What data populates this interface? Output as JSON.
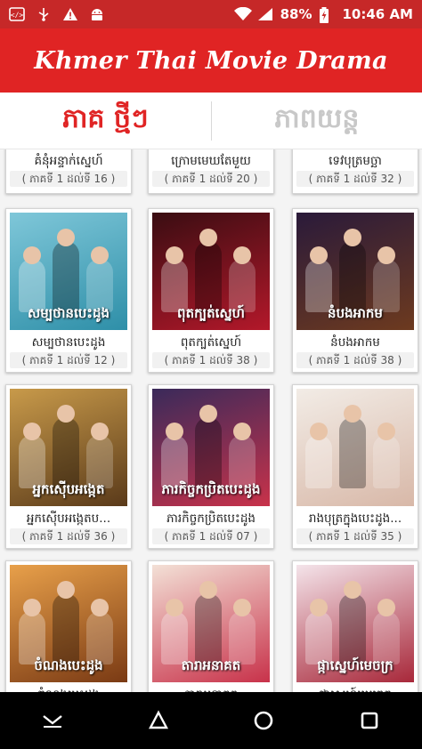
{
  "status_bar": {
    "battery": "88%",
    "time": "10:46 AM",
    "background": "#c62828"
  },
  "app_bar": {
    "title": "Khmer Thai Movie Drama",
    "background": "#e02424"
  },
  "tabs": [
    {
      "label": "ភាគ ថ្មីៗ",
      "active": true
    },
    {
      "label": "ភាពយន្ដ",
      "active": false
    }
  ],
  "partial_row": [
    {
      "title": "គំនុំអន្ទាក់ស្នេហ៍",
      "episodes": "( ភាគទី 1 ដល់ទី 16 )"
    },
    {
      "title": "ក្រោមមេឃតែមួយ",
      "episodes": "( ភាគទី 1 ដល់ទី 20 )"
    },
    {
      "title": "ទេវបុត្រមច្ឆា",
      "episodes": "( ភាគទី 1 ដល់ទី 32 )"
    }
  ],
  "dramas": [
    {
      "title": "សម្បថានបេះដូង",
      "episodes": "( ភាគទី 1 ដល់ទី 12 )",
      "poster_overlay": "សម្បថានបេះដូង",
      "colors": [
        "#7fc7d9",
        "#2e8fa8"
      ]
    },
    {
      "title": "ពុតក្បត់ស្នេហ៍",
      "episodes": "( ភាគទី 1 ដល់ទី 38 )",
      "poster_overlay": "ពុតក្បត់ស្នេហ៍",
      "colors": [
        "#3a0d12",
        "#b3182a"
      ]
    },
    {
      "title": "នំបងអាកម",
      "episodes": "( ភាគទី 1 ដល់ទី 38 )",
      "poster_overlay": "នំបងអាកម",
      "colors": [
        "#2a1a3a",
        "#6d3a1f"
      ]
    },
    {
      "title": "អ្នកស៊ើបអង្កេតប...",
      "episodes": "( ភាគទី 1 ដល់ទី 36 )",
      "poster_overlay": "អ្នកស៊ើបអង្កេត",
      "colors": [
        "#c89a4a",
        "#5a3a1a"
      ]
    },
    {
      "title": "ភារកិច្ចកប្រិតបេះដូង",
      "episodes": "( ភាគទី 1 ដល់ទី 07 )",
      "poster_overlay": "ភារកិច្ចកប្រិតបេះដូង",
      "colors": [
        "#3a2a5a",
        "#c8324a"
      ]
    },
    {
      "title": "រាងបុត្រក្នុងបេះដូង...",
      "episodes": "( ភាគទី 1 ដល់ទី 35 )",
      "poster_overlay": "",
      "colors": [
        "#f2ece6",
        "#d8b8a8"
      ]
    },
    {
      "title": "ចំណងបេះដូង",
      "episodes": "",
      "poster_overlay": "ចំណងបេះដូង",
      "colors": [
        "#e8a04a",
        "#7a3a14"
      ]
    },
    {
      "title": "តារាអនាគត",
      "episodes": "",
      "poster_overlay": "តារាអនាគត",
      "colors": [
        "#f3e0d6",
        "#c8324a"
      ]
    },
    {
      "title": "ផ្កាស្នេហ៍រមេចេក",
      "episodes": "",
      "poster_overlay": "ផ្កាស្នេហ៍មេចក្រ",
      "colors": [
        "#f4e4ea",
        "#a8283a"
      ]
    }
  ]
}
